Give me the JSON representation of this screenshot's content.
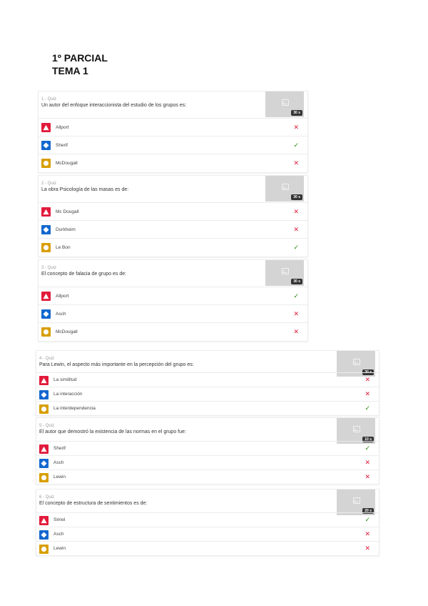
{
  "page": {
    "title_line1": "1º PARCIAL",
    "title_line2": "TEMA 1"
  },
  "quizzes": [
    {
      "meta": "1 - Quiz",
      "question": "Un autor del enfoque interaccionista del estudio de los grupos es:",
      "time": "30 s",
      "answers": [
        {
          "shape": "triangle",
          "color": "#e21b3c",
          "text": "Allport",
          "correct": false
        },
        {
          "shape": "diamond",
          "color": "#1368ce",
          "text": "Sherif",
          "correct": true
        },
        {
          "shape": "circle",
          "color": "#d89e00",
          "text": "McDougall",
          "correct": false
        }
      ]
    },
    {
      "meta": "2 - Quiz",
      "question": "La obra Psicología de las masas es de:",
      "time": "30 s",
      "answers": [
        {
          "shape": "triangle",
          "color": "#e21b3c",
          "text": "Mc Dougall",
          "correct": false
        },
        {
          "shape": "diamond",
          "color": "#1368ce",
          "text": "Durkheim",
          "correct": false
        },
        {
          "shape": "circle",
          "color": "#d89e00",
          "text": "Le Bon",
          "correct": true
        }
      ]
    },
    {
      "meta": "3 - Quiz",
      "question": "El concepto de falacia de grupo es de:",
      "time": "30 s",
      "answers": [
        {
          "shape": "triangle",
          "color": "#e21b3c",
          "text": "Allport",
          "correct": true
        },
        {
          "shape": "diamond",
          "color": "#1368ce",
          "text": "Asch",
          "correct": false
        },
        {
          "shape": "circle",
          "color": "#d89e00",
          "text": "McDougall",
          "correct": false
        }
      ]
    },
    {
      "meta": "4 - Quiz",
      "question": "Para Lewin, el aspecto más importante en la percepción del grupo es:",
      "time": "30 s",
      "answers": [
        {
          "shape": "triangle",
          "color": "#e21b3c",
          "text": "La similitud",
          "correct": false
        },
        {
          "shape": "diamond",
          "color": "#1368ce",
          "text": "La interacción",
          "correct": false
        },
        {
          "shape": "circle",
          "color": "#d89e00",
          "text": "La interdependencia",
          "correct": true
        }
      ]
    },
    {
      "meta": "5 - Quiz",
      "question": "El autor que demostró la existencia de las normas en el grupo fue:",
      "time": "10 s",
      "answers": [
        {
          "shape": "triangle",
          "color": "#e21b3c",
          "text": "Sherif",
          "correct": true
        },
        {
          "shape": "diamond",
          "color": "#1368ce",
          "text": "Asch",
          "correct": false
        },
        {
          "shape": "circle",
          "color": "#d89e00",
          "text": "Lewin",
          "correct": false
        }
      ]
    },
    {
      "meta": "6 - Quiz",
      "question": "El concepto de estructura de sentimientos es de:",
      "time": "20 s",
      "answers": [
        {
          "shape": "triangle",
          "color": "#e21b3c",
          "text": "Simel",
          "correct": true
        },
        {
          "shape": "diamond",
          "color": "#1368ce",
          "text": "Asch",
          "correct": false
        },
        {
          "shape": "circle",
          "color": "#d89e00",
          "text": "Lewin",
          "correct": false
        }
      ]
    }
  ]
}
